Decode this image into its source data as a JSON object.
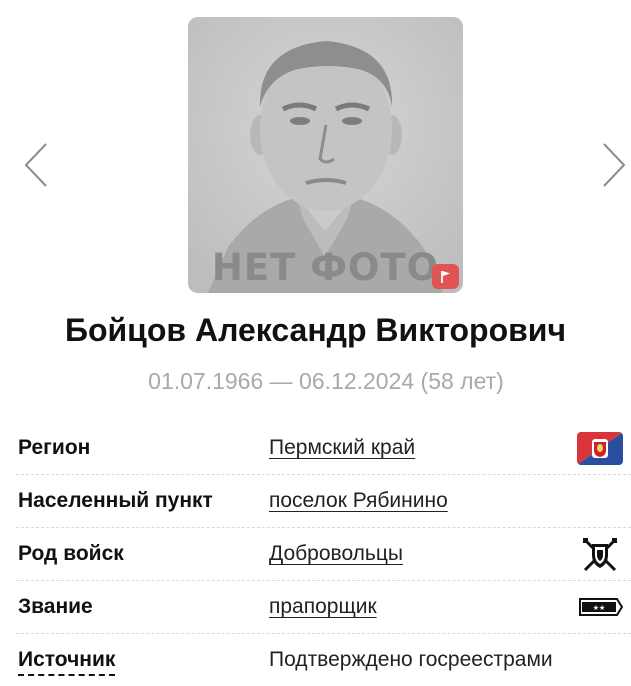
{
  "carousel": {
    "prev_icon": "chevron-left-icon",
    "next_icon": "chevron-right-icon",
    "no_photo_label": "НЕТ ФОТО",
    "report_icon": "flag-icon",
    "report_color": "#e05454"
  },
  "person": {
    "name": "Бойцов Александр Викторович",
    "dates": "01.07.1966 — 06.12.2024 (58 лет)"
  },
  "info": {
    "rows": [
      {
        "label": "Регион",
        "value": "Пермский край",
        "icon": "perm-krai-flag-icon"
      },
      {
        "label": "Населенный пункт",
        "value": "поселок Рябинино",
        "icon": ""
      },
      {
        "label": "Род войск",
        "value": "Добровольцы",
        "icon": "volunteers-emblem-icon"
      },
      {
        "label": "Звание",
        "value": "прапорщик",
        "icon": "shoulder-strap-icon"
      },
      {
        "label": "Источник",
        "value": "Подтверждено госреестрами",
        "icon": ""
      }
    ]
  },
  "colors": {
    "text": "#111111",
    "muted": "#a9a9a9",
    "divider": "#d9d9d9",
    "flag_red": "#d8343a",
    "flag_blue": "#2b4fa0"
  }
}
